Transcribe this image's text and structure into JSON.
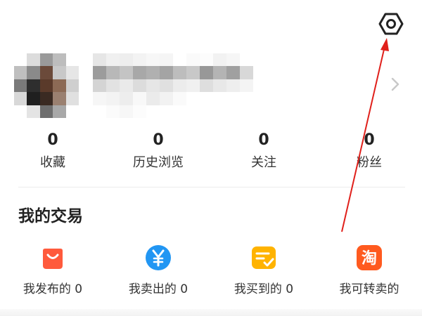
{
  "header": {
    "settings_icon": "hexagon-settings-icon"
  },
  "profile": {
    "chevron_icon": "chevron-right-icon"
  },
  "stats": [
    {
      "value": "0",
      "label": "收藏"
    },
    {
      "value": "0",
      "label": "历史浏览"
    },
    {
      "value": "0",
      "label": "关注"
    },
    {
      "value": "0",
      "label": "粉丝"
    }
  ],
  "trade_section": {
    "title": "我的交易",
    "items": [
      {
        "label": "我发布的 0",
        "icon": "shopping-bag-icon",
        "color": "#ff5a3c"
      },
      {
        "label": "我卖出的 0",
        "icon": "yen-icon",
        "color": "#2196f3"
      },
      {
        "label": "我买到的 0",
        "icon": "checklist-icon",
        "color": "#ffb300"
      },
      {
        "label": "我可转卖的",
        "icon": "tao-icon",
        "color": "#ff5a1f",
        "glyph": "淘"
      }
    ]
  },
  "colors": {
    "annotation_arrow": "#e0201b"
  }
}
